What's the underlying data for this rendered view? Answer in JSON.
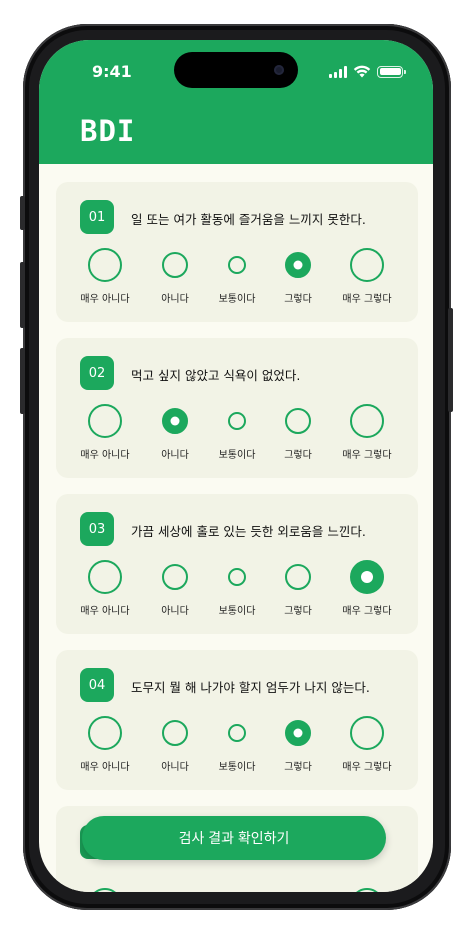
{
  "status_bar": {
    "time": "9:41"
  },
  "header": {
    "title": "BDI"
  },
  "options": [
    "매우 아니다",
    "아니다",
    "보통이다",
    "그렇다",
    "매우 그렇다"
  ],
  "questions": [
    {
      "num": "01",
      "text": "일 또는 여가 활동에 즐거움을 느끼지 못한다.",
      "selected": 3
    },
    {
      "num": "02",
      "text": "먹고 싶지 않았고 식욕이 없었다.",
      "selected": 1
    },
    {
      "num": "03",
      "text": "가끔 세상에 홀로 있는 듯한 외로움을 느낀다.",
      "selected": 4
    },
    {
      "num": "04",
      "text": "도무지 뭘 해 나가야 할지 엄두가 나지 않는다.",
      "selected": 3
    },
    {
      "num": "",
      "text": "",
      "selected": 3
    }
  ],
  "cta": {
    "label": "검사 결과 확인하기"
  },
  "colors": {
    "accent": "#1ca85d",
    "card": "#f2f3e6",
    "background": "#fbfbf2"
  }
}
